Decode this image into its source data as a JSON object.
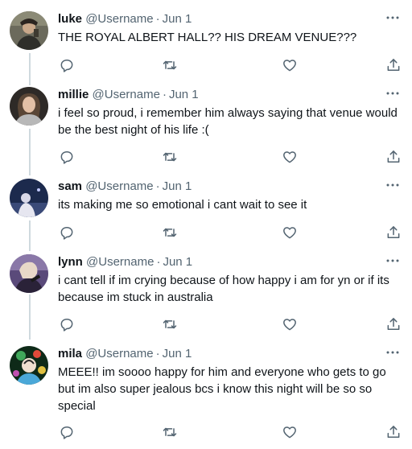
{
  "tweets": [
    {
      "name": "luke",
      "handle": "@Username",
      "separator": "·",
      "time": "Jun 1",
      "text": "THE ROYAL ALBERT HALL?? HIS DREAM VENUE???",
      "avatar_color": "#5a5a4e"
    },
    {
      "name": "millie",
      "handle": "@Username",
      "separator": "·",
      "time": "Jun 1",
      "text": "i feel so proud, i remember him always saying that venue would be the best night of his life :(",
      "avatar_color": "#3b3633"
    },
    {
      "name": "sam",
      "handle": "@Username",
      "separator": "·",
      "time": "Jun 1",
      "text": "its making me so emotional i cant wait to see it",
      "avatar_color": "#1f2c52"
    },
    {
      "name": "lynn",
      "handle": "@Username",
      "separator": "·",
      "time": "Jun 1",
      "text": "i cant tell if im crying because of how happy i am for yn or if its because im stuck in australia",
      "avatar_color": "#6a5a86"
    },
    {
      "name": "mila",
      "handle": "@Username",
      "separator": "·",
      "time": "Jun 1",
      "text": "MEEE!! im soooo happy for him and everyone who gets to go but im also super jealous bcs i know this night will be so so special",
      "avatar_color": "#1a4a2a"
    }
  ],
  "icons": {
    "reply": "reply-icon",
    "retweet": "retweet-icon",
    "like": "heart-icon",
    "share": "share-icon",
    "more": "more-icon"
  },
  "colors": {
    "text": "#0f1419",
    "secondary": "#536471",
    "thread_line": "#cfd9de"
  }
}
